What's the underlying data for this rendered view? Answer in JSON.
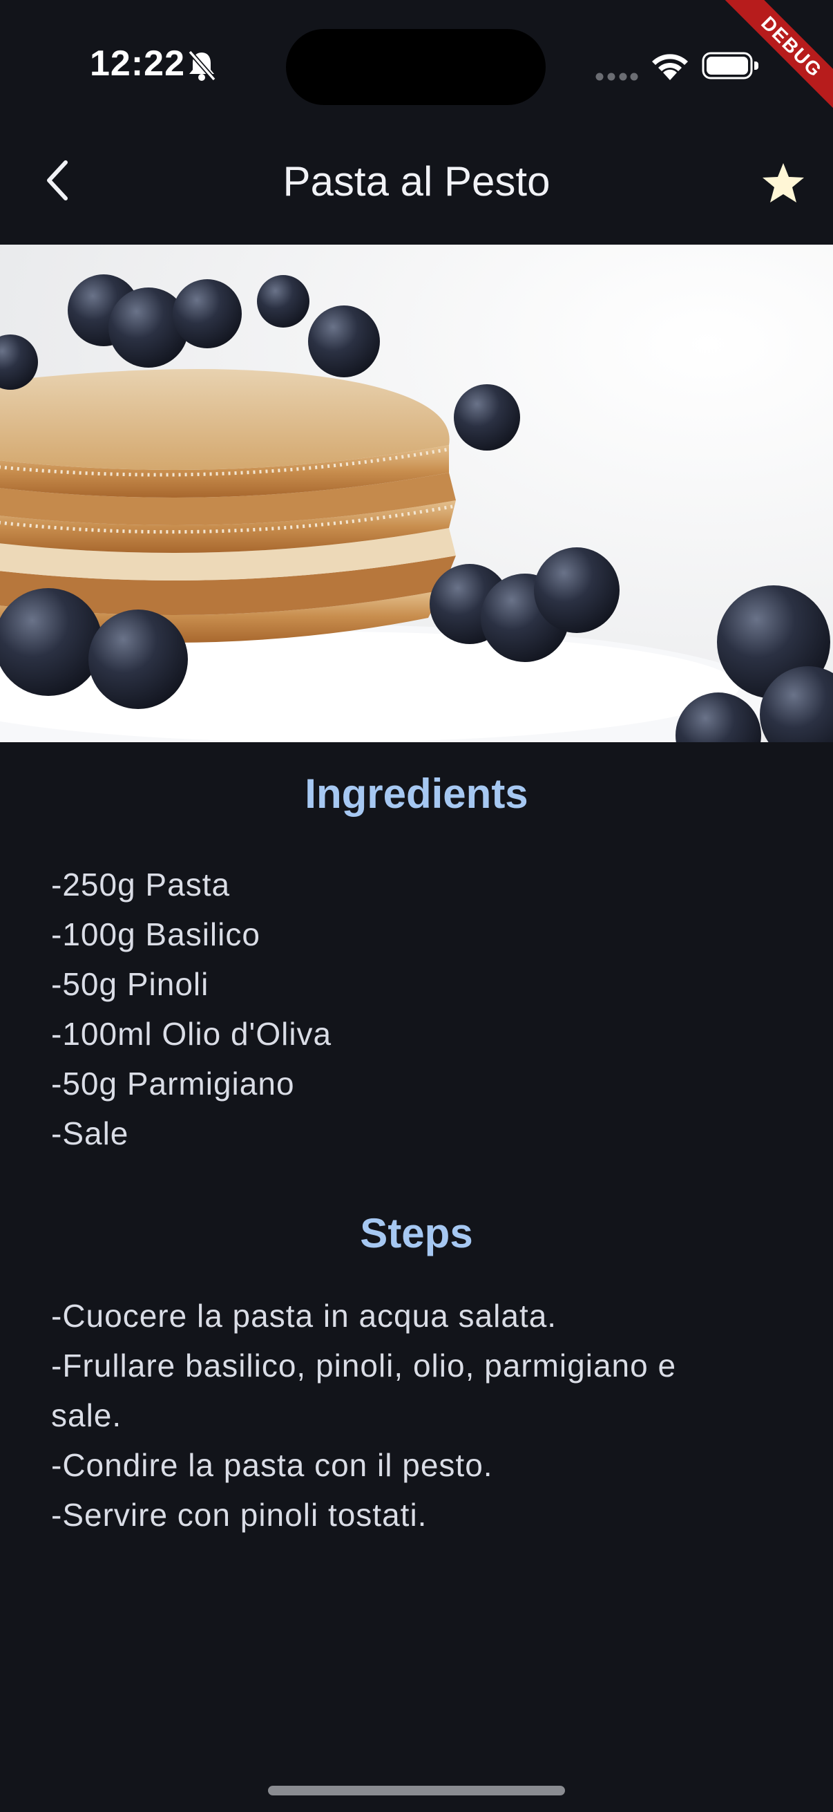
{
  "status_bar": {
    "time": "12:22",
    "icons": [
      "bell-slash-icon",
      "cellular-signal-icon",
      "wifi-icon",
      "battery-icon"
    ],
    "debug_banner": "DEBUG"
  },
  "app_bar": {
    "title": "Pasta al Pesto",
    "back_icon": "chevron-left-icon",
    "favorite_icon": "star-icon",
    "favorite_color": "#fff6d6"
  },
  "hero_image": {
    "subject": "stack of pancakes with blueberries on a white plate"
  },
  "ingredients": {
    "title": "Ingredients",
    "items": [
      "-250g Pasta",
      "-100g Basilico",
      "-50g Pinoli",
      "-100ml Olio d'Oliva",
      "-50g Parmigiano",
      "-Sale"
    ]
  },
  "steps": {
    "title": "Steps",
    "lines": [
      "-Cuocere la pasta in acqua salata.",
      "-Frullare basilico, pinoli, olio, parmigiano e",
      "sale.",
      "-Condire la pasta con il pesto.",
      "-Servire con pinoli tostati."
    ]
  },
  "theme": {
    "background": "#12141a",
    "heading_color": "#a6c8f2",
    "text_color": "#dadde6"
  }
}
